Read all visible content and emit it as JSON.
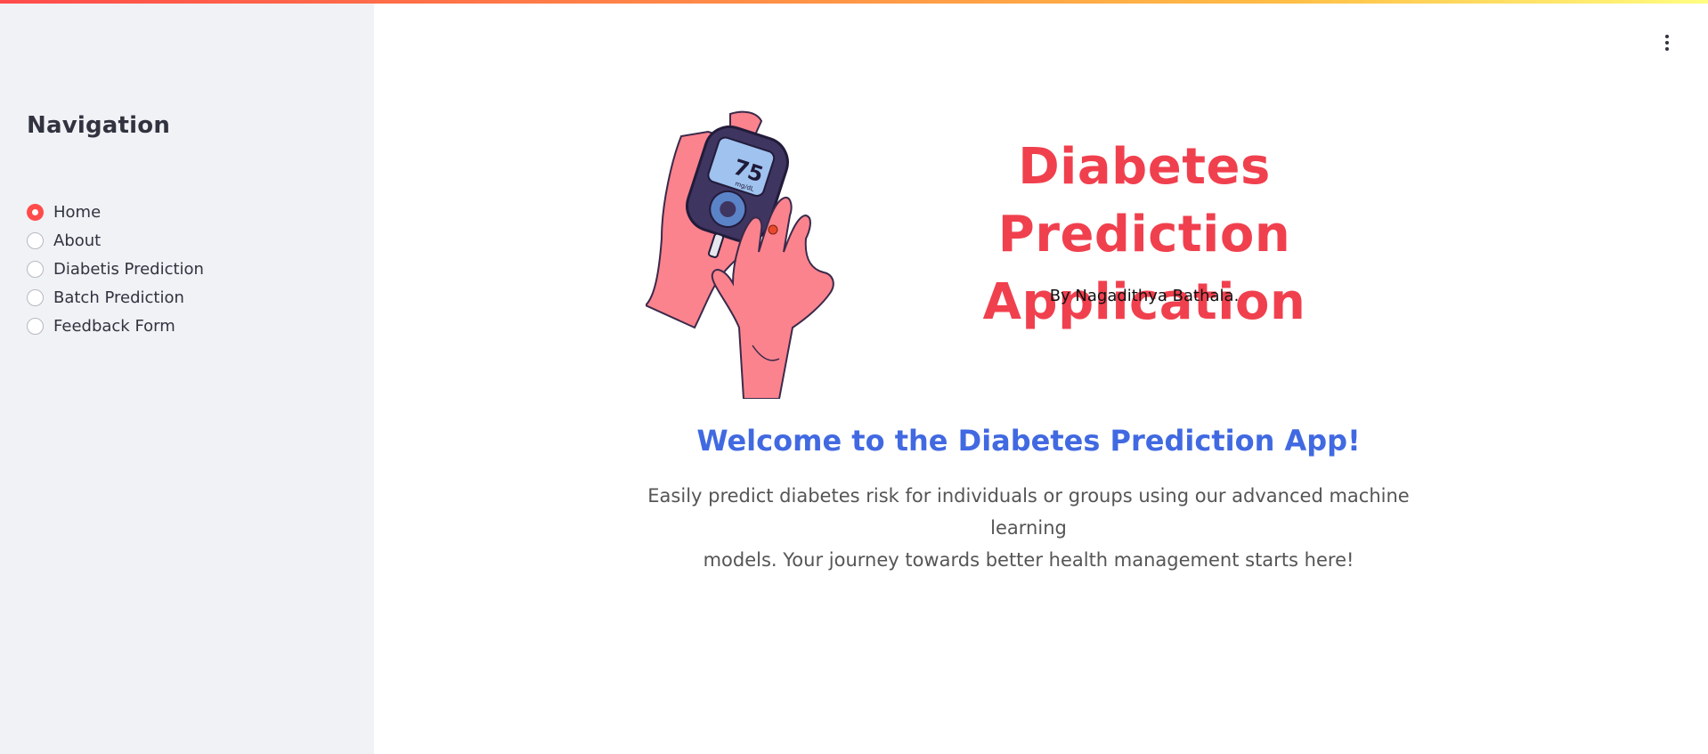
{
  "sidebar": {
    "title": "Navigation",
    "items": [
      {
        "label": "Home",
        "selected": true
      },
      {
        "label": "About",
        "selected": false
      },
      {
        "label": "Diabetis Prediction",
        "selected": false
      },
      {
        "label": "Batch Prediction",
        "selected": false
      },
      {
        "label": "Feedback Form",
        "selected": false
      }
    ]
  },
  "header": {
    "menu_icon": "vertical-ellipsis-icon"
  },
  "hero": {
    "illustration_icon": "glucose-meter-hands-illustration",
    "meter_reading": "75",
    "meter_unit": "mg/dL",
    "title_line1": "Diabetes Prediction",
    "title_line2": "Application",
    "author": "By Nagadithya Bathala."
  },
  "main": {
    "welcome": "Welcome to the Diabetes Prediction App!",
    "description_line1": "Easily predict diabetes risk for individuals or groups using our advanced machine learning",
    "description_line2": "models. Your journey towards better health management starts here!"
  },
  "colors": {
    "accent": "#ff4b4b",
    "title": "#f0404e",
    "welcome": "#4169e1",
    "sidebar_bg": "#f0f2f6"
  }
}
